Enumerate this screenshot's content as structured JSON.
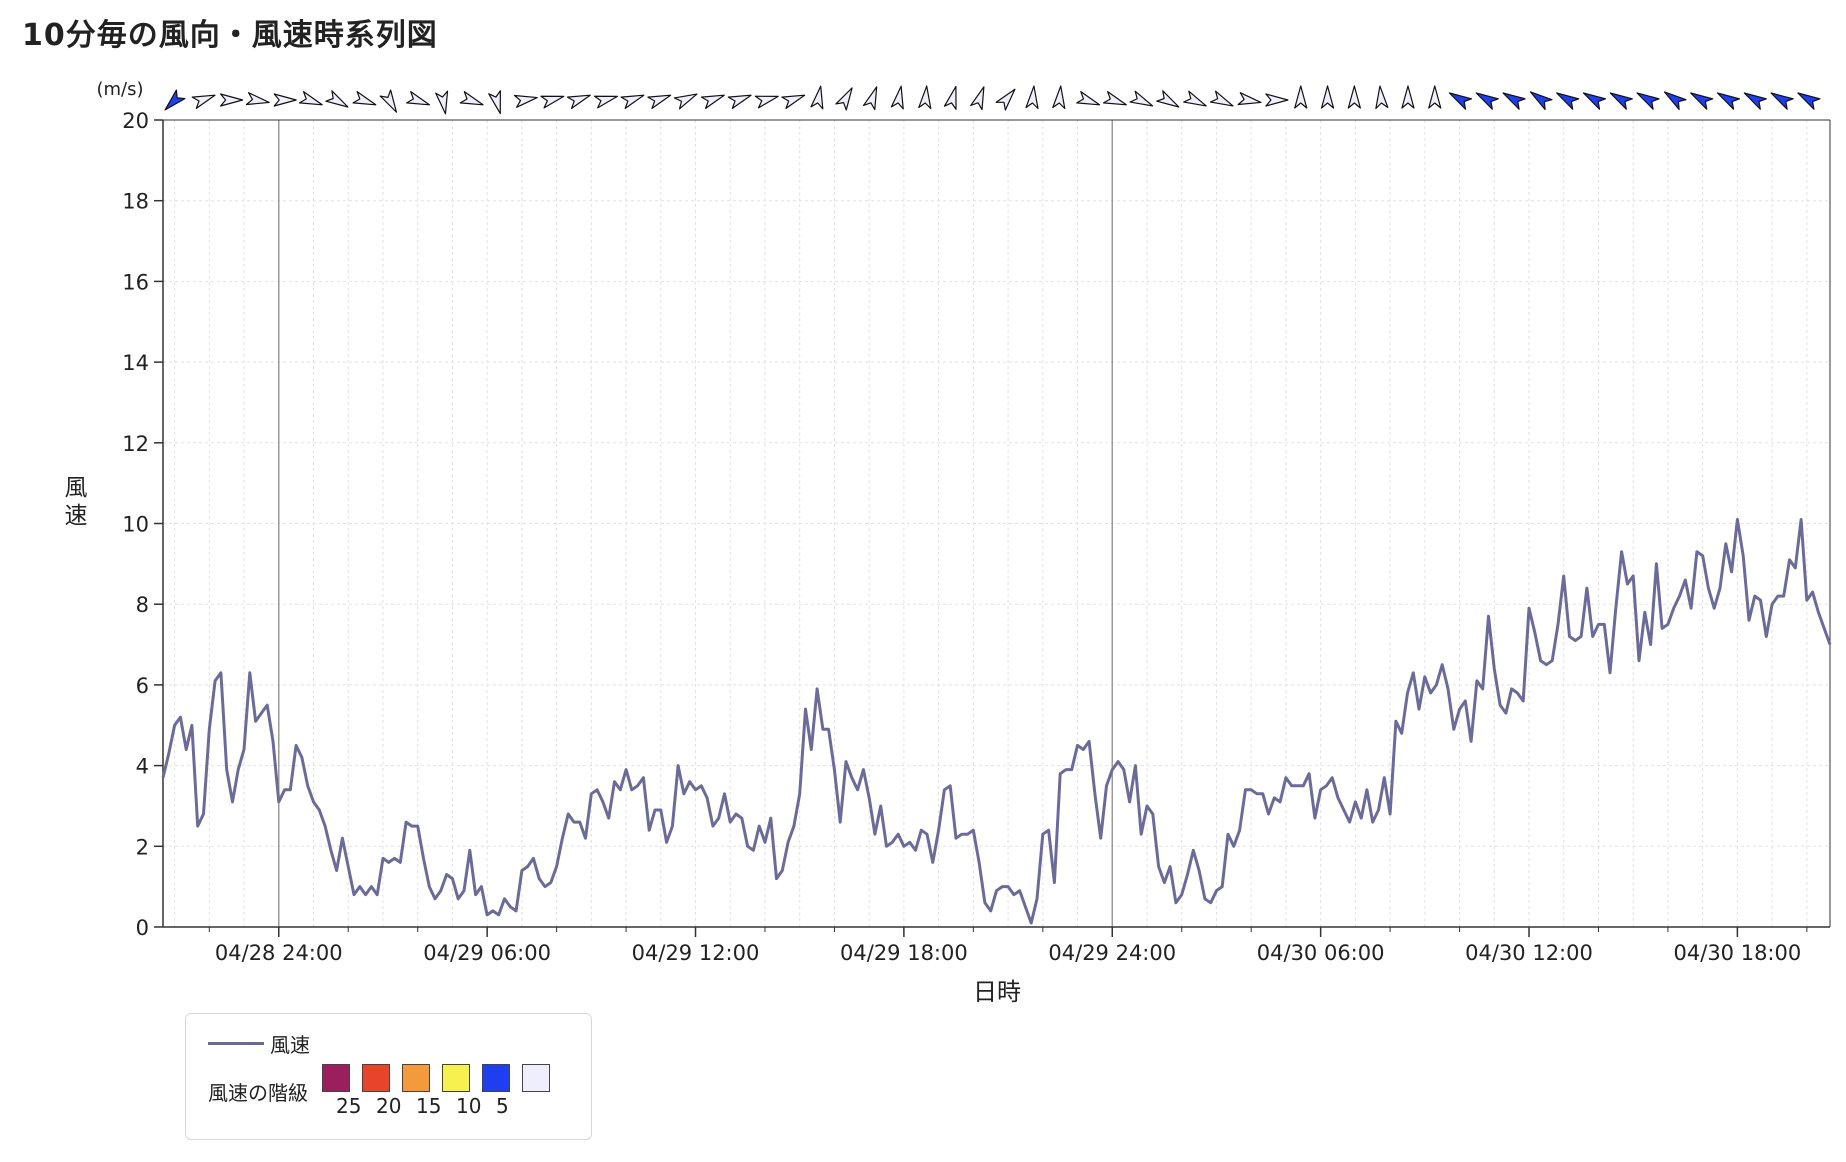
{
  "title": "10分毎の風向・風速時系列図",
  "chart_data": {
    "type": "line",
    "unit_label": "(m/s)",
    "ylabel": "風速",
    "xlabel": "日時",
    "ylim": [
      0,
      20
    ],
    "y_ticks": [
      "0",
      "2",
      "4",
      "6",
      "8",
      "10",
      "12",
      "14",
      "16",
      "18",
      "20"
    ],
    "x_start": "04/28 20:40",
    "x_end": "04/30 20:40",
    "interval_minutes": 10,
    "x_ticks": [
      {
        "time": "04/28 24:00",
        "label": "04/28 24:00"
      },
      {
        "time": "04/29 06:00",
        "label": "04/29 06:00"
      },
      {
        "time": "04/29 12:00",
        "label": "04/29 12:00"
      },
      {
        "time": "04/29 18:00",
        "label": "04/29 18:00"
      },
      {
        "time": "04/29 24:00",
        "label": "04/29 24:00"
      },
      {
        "time": "04/30 06:00",
        "label": "04/30 06:00"
      },
      {
        "time": "04/30 12:00",
        "label": "04/30 12:00"
      },
      {
        "time": "04/30 18:00",
        "label": "04/30 18:00"
      }
    ],
    "day_boundaries": [
      "04/28 24:00",
      "04/29 24:00"
    ],
    "grid": true,
    "series": [
      {
        "name": "風速",
        "color": "#6b6b9a",
        "values": [
          3.7,
          4.3,
          5.0,
          5.2,
          4.4,
          5.0,
          2.5,
          2.8,
          4.9,
          6.1,
          6.3,
          3.9,
          3.1,
          3.9,
          4.4,
          6.3,
          5.1,
          5.3,
          5.5,
          4.6,
          3.1,
          3.4,
          3.4,
          4.5,
          4.2,
          3.5,
          3.1,
          2.9,
          2.5,
          1.9,
          1.4,
          2.2,
          1.5,
          0.8,
          1.0,
          0.8,
          1.0,
          0.8,
          1.7,
          1.6,
          1.7,
          1.6,
          2.6,
          2.5,
          2.5,
          1.7,
          1.0,
          0.7,
          0.9,
          1.3,
          1.2,
          0.7,
          0.9,
          1.9,
          0.8,
          1.0,
          0.3,
          0.4,
          0.3,
          0.7,
          0.5,
          0.4,
          1.4,
          1.5,
          1.7,
          1.2,
          1.0,
          1.1,
          1.5,
          2.2,
          2.8,
          2.6,
          2.6,
          2.2,
          3.3,
          3.4,
          3.1,
          2.7,
          3.6,
          3.4,
          3.9,
          3.4,
          3.5,
          3.7,
          2.4,
          2.9,
          2.9,
          2.1,
          2.5,
          4.0,
          3.3,
          3.6,
          3.4,
          3.5,
          3.2,
          2.5,
          2.7,
          3.3,
          2.6,
          2.8,
          2.7,
          2.0,
          1.9,
          2.5,
          2.1,
          2.7,
          1.2,
          1.4,
          2.1,
          2.5,
          3.3,
          5.4,
          4.4,
          5.9,
          4.9,
          4.9,
          3.9,
          2.6,
          4.1,
          3.7,
          3.4,
          3.9,
          3.2,
          2.3,
          3.0,
          2.0,
          2.1,
          2.3,
          2.0,
          2.1,
          1.9,
          2.4,
          2.3,
          1.6,
          2.4,
          3.4,
          3.5,
          2.2,
          2.3,
          2.3,
          2.4,
          1.6,
          0.6,
          0.4,
          0.9,
          1.0,
          1.0,
          0.8,
          0.9,
          0.5,
          0.1,
          0.7,
          2.3,
          2.4,
          1.1,
          3.8,
          3.9,
          3.9,
          4.5,
          4.4,
          4.6,
          3.3,
          2.2,
          3.5,
          3.9,
          4.1,
          3.9,
          3.1,
          4.0,
          2.3,
          3.0,
          2.8,
          1.5,
          1.1,
          1.5,
          0.6,
          0.8,
          1.3,
          1.9,
          1.4,
          0.7,
          0.6,
          0.9,
          1.0,
          2.3,
          2.0,
          2.4,
          3.4,
          3.4,
          3.3,
          3.3,
          2.8,
          3.2,
          3.1,
          3.7,
          3.5,
          3.5,
          3.5,
          3.8,
          2.7,
          3.4,
          3.5,
          3.7,
          3.2,
          2.9,
          2.6,
          3.1,
          2.7,
          3.4,
          2.6,
          2.9,
          3.7,
          2.8,
          5.1,
          4.8,
          5.8,
          6.3,
          5.4,
          6.2,
          5.8,
          6.0,
          6.5,
          5.9,
          4.9,
          5.4,
          5.6,
          4.6,
          6.1,
          5.9,
          7.7,
          6.4,
          5.5,
          5.3,
          5.9,
          5.8,
          5.6,
          7.9,
          7.3,
          6.6,
          6.5,
          6.6,
          7.5,
          8.7,
          7.2,
          7.1,
          7.2,
          8.4,
          7.2,
          7.5,
          7.5,
          6.3,
          7.9,
          9.3,
          8.5,
          8.7,
          6.6,
          7.8,
          7.0,
          9.0,
          7.4,
          7.5,
          7.9,
          8.2,
          8.6,
          7.9,
          9.3,
          9.2,
          8.4,
          7.9,
          8.4,
          9.5,
          8.8,
          10.1,
          9.2,
          7.6,
          8.2,
          8.1,
          7.2,
          8.0,
          8.2,
          8.2,
          9.1,
          8.9,
          10.1,
          8.1,
          8.3,
          7.8,
          7.4,
          7.0
        ]
      }
    ],
    "direction_arrows": {
      "note_levels": "colors per wind-speed class",
      "count": 48,
      "directions_deg": [
        225,
        70,
        90,
        100,
        90,
        110,
        120,
        110,
        150,
        110,
        170,
        110,
        165,
        80,
        75,
        70,
        75,
        70,
        70,
        65,
        70,
        70,
        75,
        70,
        10,
        30,
        20,
        10,
        5,
        15,
        20,
        40,
        5,
        5,
        110,
        110,
        115,
        120,
        115,
        115,
        100,
        90,
        0,
        0,
        0,
        355,
        0,
        0,
        300,
        300,
        300,
        305,
        300,
        300,
        300,
        300,
        305,
        300,
        300,
        300,
        300,
        300
      ],
      "speed_class": [
        5,
        1,
        1,
        1,
        1,
        1,
        1,
        1,
        1,
        1,
        1,
        1,
        1,
        1,
        1,
        1,
        1,
        1,
        1,
        1,
        1,
        1,
        1,
        1,
        1,
        1,
        1,
        1,
        1,
        1,
        1,
        1,
        1,
        1,
        1,
        1,
        1,
        1,
        1,
        1,
        1,
        1,
        1,
        1,
        1,
        1,
        1,
        1,
        5,
        5,
        5,
        5,
        5,
        5,
        5,
        5,
        5,
        5,
        5,
        5,
        5,
        5
      ]
    }
  },
  "legend": {
    "series_label": "風速",
    "class_label": "風速の階級",
    "classes": [
      {
        "color": "#9b1f5c",
        "label": "25"
      },
      {
        "color": "#e8442a",
        "label": "20"
      },
      {
        "color": "#f39a3c",
        "label": "15"
      },
      {
        "color": "#f7f150",
        "label": "10"
      },
      {
        "color": "#1f3ef0",
        "label": "5"
      },
      {
        "color": "#eeeefc",
        "label": ""
      }
    ]
  }
}
